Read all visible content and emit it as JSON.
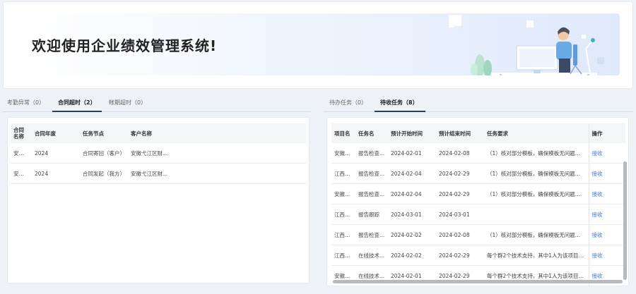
{
  "banner": {
    "title": "欢迎使用企业绩效管理系统!"
  },
  "left_panel": {
    "tabs": [
      {
        "label": "考勤异常（0）",
        "active": false
      },
      {
        "label": "合同超时（2）",
        "active": true
      },
      {
        "label": "帐期超时（0）",
        "active": false
      }
    ],
    "columns": [
      "合同名称",
      "合同年度",
      "任务节点",
      "客户名称"
    ],
    "rows": [
      [
        "安徽...",
        "2024",
        "合同寄回（客户）",
        "安徽弋江区财..."
      ],
      [
        "安徽...",
        "2024",
        "合同发起（我方）",
        "安徽弋江区财..."
      ]
    ]
  },
  "right_panel": {
    "tabs": [
      {
        "label": "待办任务（0）",
        "active": false
      },
      {
        "label": "待收任务（8）",
        "active": true
      }
    ],
    "columns": [
      "项目名",
      "任务名",
      "预计开始时间",
      "预计结束时间",
      "任务要求",
      "操作"
    ],
    "rows": [
      [
        "安徽...",
        "报告检查...",
        "2024-02-01",
        "2024-02-08",
        "（1）核对部分模板，确保模板无问题；（...",
        "接收"
      ],
      [
        "江西...",
        "报告检查...",
        "2024-02-04",
        "2024-02-29",
        "（1）核对部分模板，确保模板无问题；（...",
        "接收"
      ],
      [
        "安徽...",
        "报告检查...",
        "2024-02-04",
        "2024-02-29",
        "（1）核对部分模板，确保模板无问题；（...",
        "接收"
      ],
      [
        "江西...",
        "报告跟踪",
        "2024-03-01",
        "2024-03-01",
        "",
        "接收"
      ],
      [
        "江西...",
        "报告检查...",
        "2024-02-02",
        "2024-02-08",
        "（1）核对部分模板，确保模板无问题；（...",
        "接收"
      ],
      [
        "江西...",
        "在线技术...",
        "2024-02-02",
        "2024-02-29",
        "每个群2个技术支持，其中1人为该项目技...",
        "接收"
      ],
      [
        "安徽...",
        "在线技术...",
        "2024-02-01",
        "2024-02-29",
        "每个群2个技术支持，其中1人为该项目技...",
        "接收"
      ]
    ]
  },
  "colors": {
    "accent": "#2c3e50",
    "link": "#3b78e7",
    "banner_gradient_end": "#dfe9fb"
  }
}
